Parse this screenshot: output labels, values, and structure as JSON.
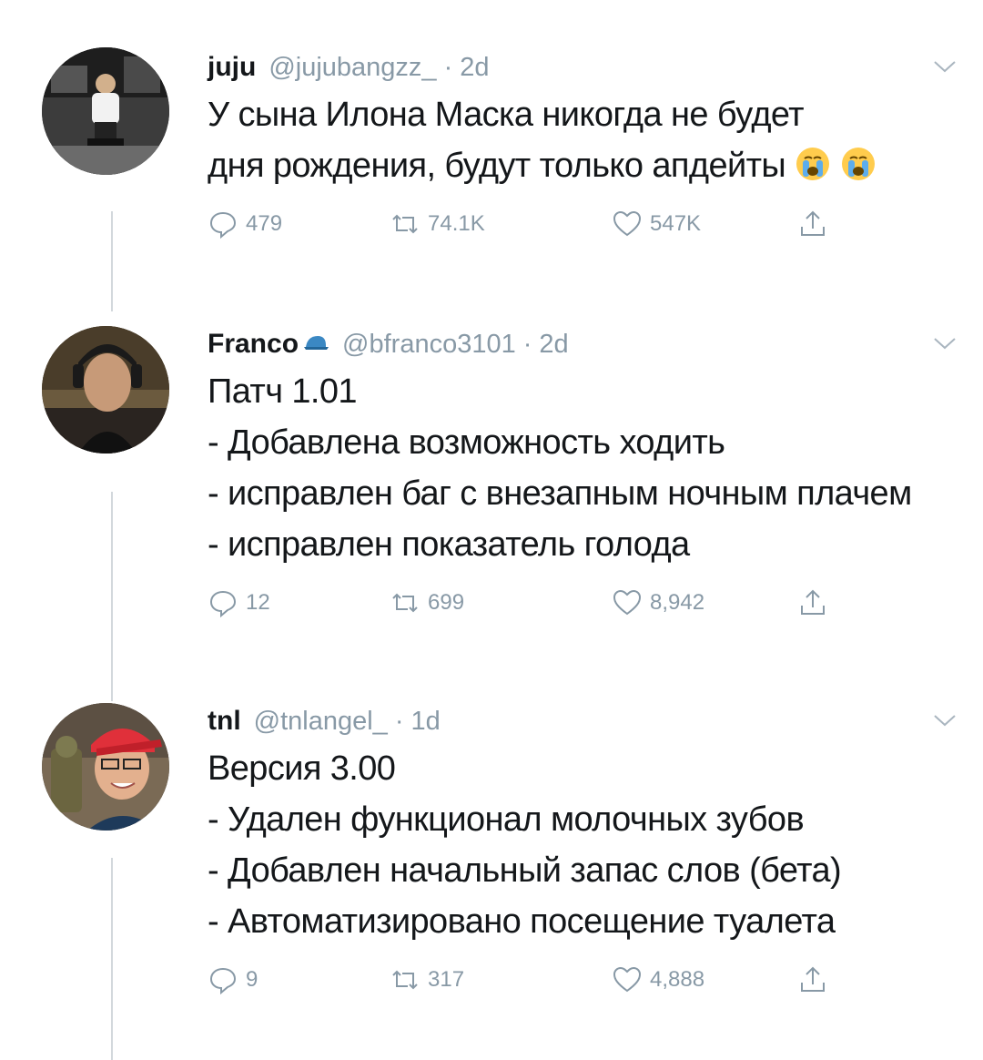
{
  "tweets": [
    {
      "name": "juju",
      "verified": false,
      "handle": "@jujubangzz_",
      "separator": "·",
      "time": "2d",
      "lines": [
        "У сына Илона Маска никогда не будет",
        "дня рождения, будут только апдейты"
      ],
      "emojis": [
        "loudly-crying-face",
        "loudly-crying-face"
      ],
      "replies": "479",
      "retweets": "74.1K",
      "likes": "547K"
    },
    {
      "name": "Franco",
      "verified": false,
      "badge_icon": "blue-cap-emoji",
      "handle": "@bfranco3101",
      "separator": "·",
      "time": "2d",
      "lines": [
        "Патч 1.01",
        "- Добавлена возможность ходить",
        "- исправлен баг с внезапным ночным плачем",
        "- исправлен показатель голода"
      ],
      "replies": "12",
      "retweets": "699",
      "likes": "8,942"
    },
    {
      "name": "tnl",
      "verified": false,
      "handle": "@tnlangel_",
      "separator": "·",
      "time": "1d",
      "lines": [
        "Версия 3.00",
        "- Удален функционал молочных зубов",
        "- Добавлен начальный запас слов (бета)",
        "- Автоматизировано посещение туалета"
      ],
      "replies": "9",
      "retweets": "317",
      "likes": "4,888"
    }
  ],
  "colors": {
    "text": "#14171a",
    "muted": "#8899a6",
    "thread_line": "#d3d8dc",
    "background": "#ffffff"
  }
}
